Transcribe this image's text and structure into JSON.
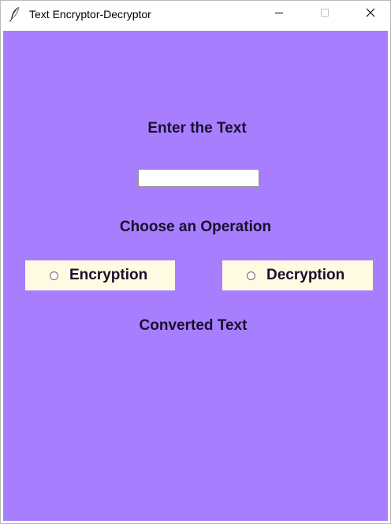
{
  "window": {
    "title": "Text Encryptor-Decryptor",
    "icon": "feather-icon",
    "controls": [
      "minimize-icon",
      "maximize-icon",
      "close-icon"
    ]
  },
  "form": {
    "enter_label": "Enter the Text",
    "input_value": "",
    "choose_label": "Choose an Operation",
    "options": [
      {
        "label": "Encryption",
        "selected": false
      },
      {
        "label": "Decryption",
        "selected": false
      }
    ],
    "converted_label": "Converted Text",
    "converted_value": ""
  },
  "colors": {
    "background": "#a77ffe",
    "option_background": "#fffbe3",
    "text": "#1a0f2e"
  }
}
